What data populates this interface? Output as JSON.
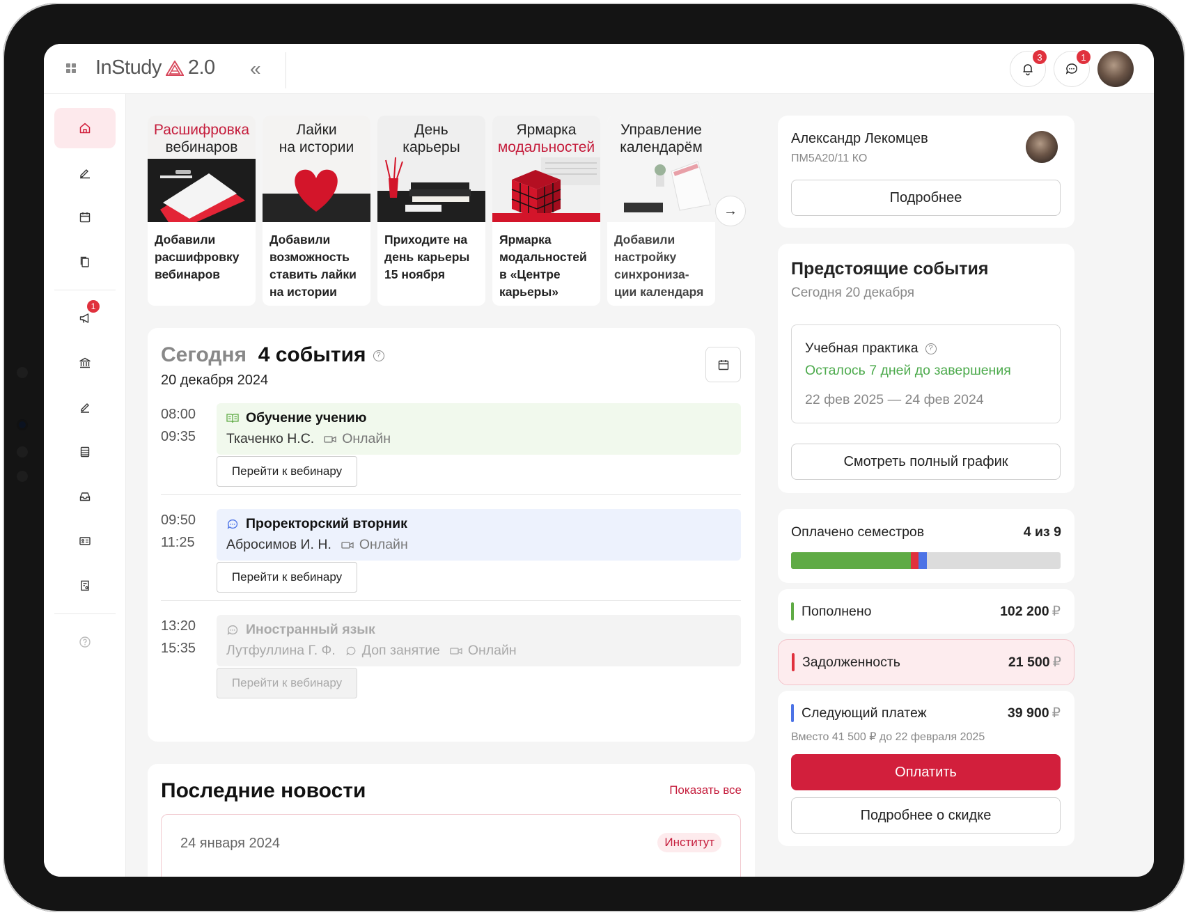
{
  "app": {
    "name": "InStudy",
    "version": "2.0"
  },
  "topbar": {
    "notifications_count": "3",
    "messages_count": "1"
  },
  "sidebar": {
    "announcements_badge": "1"
  },
  "stories": [
    {
      "title_plain": "Расшифровка",
      "title_red": "",
      "title_line2": "вебинаров",
      "text": "Добавили\nрасшифровку\nвебинаров"
    },
    {
      "title_plain": "Лайки",
      "title_red": "",
      "title_line2": "на истории",
      "text": "Добавили\nвозможность\nставить лайки\nна истории"
    },
    {
      "title_plain": "День",
      "title_red": "",
      "title_line2": "карьеры",
      "text": "Приходите на\nдень карьеры\n15 ноября"
    },
    {
      "title_plain": "Ярмарка",
      "title_red": "",
      "title_line2": "модальностей",
      "text": "Ярмарка\nмодальностей\nв «Центре\nкарьеры»"
    },
    {
      "title_plain": "Управление",
      "title_red": "",
      "title_line2": "календарём",
      "text": "Добавили\nнастройку\nсинхрониза-\nции календаря"
    }
  ],
  "today": {
    "label": "Сегодня",
    "count": "4 события",
    "date": "20 декабря 2024",
    "events": [
      {
        "start": "08:00",
        "end": "09:35",
        "title": "Обучение учению",
        "teacher": "Ткаченко Н.С.",
        "extra": "",
        "mode": "Онлайн",
        "button": "Перейти к вебинару"
      },
      {
        "start": "09:50",
        "end": "11:25",
        "title": "Проректорский вторник",
        "teacher": "Абросимов И. Н.",
        "extra": "",
        "mode": "Онлайн",
        "button": "Перейти к вебинару"
      },
      {
        "start": "13:20",
        "end": "15:35",
        "title": "Иностранный язык",
        "teacher": "Лутфуллина Г. Ф.",
        "extra": "Доп занятие",
        "mode": "Онлайн",
        "button": "Перейти к вебинару"
      }
    ]
  },
  "news": {
    "title": "Последние новости",
    "show_all": "Показать все",
    "items": [
      {
        "date": "24 января 2024",
        "tag": "Институт"
      }
    ]
  },
  "profile": {
    "name": "Александр Лекомцев",
    "group": "ПМ5А20/11 КО",
    "button": "Подробнее"
  },
  "upcoming": {
    "title": "Предстоящие события",
    "date": "Сегодня 20 декабря",
    "practice_title": "Учебная практика",
    "practice_status": "Осталось 7 дней до завершения",
    "practice_dates": "22 фев 2025 — 24 фев 2024",
    "button": "Смотреть полный график"
  },
  "semesters": {
    "label": "Оплачено семестров",
    "value": "4 из 9",
    "paid_fraction": 0.444
  },
  "payments": {
    "topped_label": "Пополнено",
    "topped_value": "102 200",
    "debt_label": "Задолженность",
    "debt_value": "21 500",
    "next_label": "Следующий платеж",
    "next_value": "39 900",
    "currency": "₽",
    "note": "Вместо 41 500 ₽ до 22 февраля 2025",
    "pay_button": "Оплатить",
    "discount_button": "Подробнее о скидке"
  },
  "colors": {
    "accent": "#d21f3c",
    "green": "#5fab45",
    "blue": "#4c73e6",
    "red": "#e0313d"
  }
}
